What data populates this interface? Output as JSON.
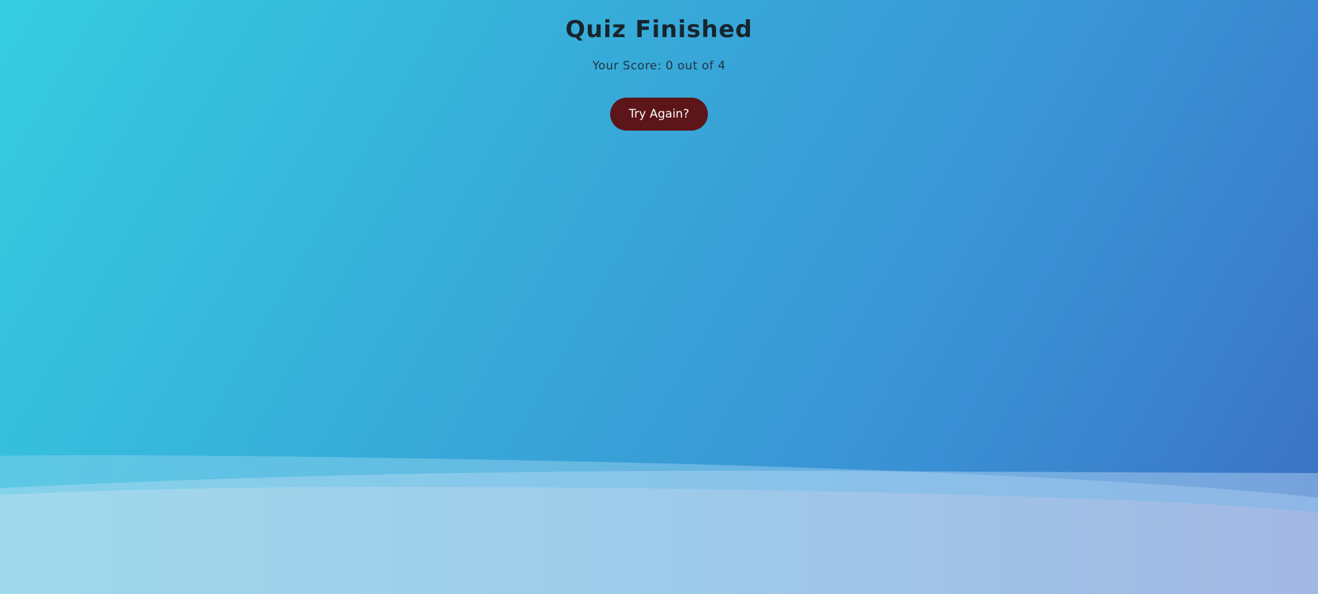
{
  "quiz": {
    "title": "Quiz Finished",
    "score_prefix": "Your Score:",
    "score_value": "0",
    "score_mid": "out of",
    "score_total": "4",
    "retry_label": "Try Again?"
  },
  "colors": {
    "button_bg": "#5c1519",
    "button_text": "#ffffff",
    "title_text": "#17252e",
    "background_start": "#35cde0",
    "background_end": "#3b6fc2"
  }
}
